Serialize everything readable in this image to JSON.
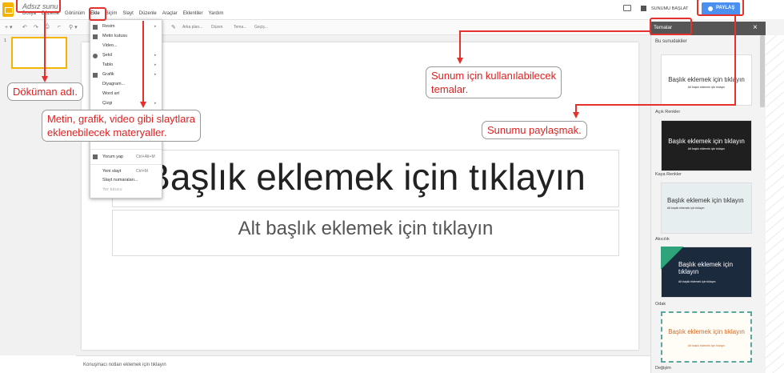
{
  "app": {
    "doc_title": "Adsız sunu",
    "menus": [
      "Dosya",
      "Düzenle",
      "Görünüm",
      "Ekle",
      "Biçim",
      "Slayt",
      "Düzenle",
      "Araçlar",
      "Eklentiler",
      "Yardım"
    ],
    "present_label": "SUNUMU BAŞLAT",
    "share_label": "PAYLAŞ"
  },
  "toolbar": {
    "items": [
      "Arka plan...",
      "Düzen",
      "Tema...",
      "Geçiş..."
    ]
  },
  "slides_panel": {
    "slide_number": "1"
  },
  "slide": {
    "title_placeholder": "Başlık eklemek için tıklayın",
    "subtitle_placeholder": "Alt başlık eklemek için tıklayın"
  },
  "notes": {
    "placeholder": "Konuşmacı notları eklemek için tıklayın"
  },
  "insert_menu": {
    "items": [
      {
        "label": "Resim",
        "arrow": "▸"
      },
      {
        "label": "Metin kutusu",
        "arrow": ""
      },
      {
        "label": "Video...",
        "arrow": ""
      },
      {
        "label": "Şekil",
        "arrow": "▸"
      },
      {
        "label": "Tablo",
        "arrow": "▸"
      },
      {
        "label": "Grafik",
        "arrow": "▸"
      },
      {
        "label": "Diyagram...",
        "arrow": ""
      },
      {
        "label": "Word art",
        "arrow": ""
      },
      {
        "label": "Çizgi",
        "arrow": "▸"
      },
      {
        "label": "Yorum yap",
        "shortcut": "Ctrl+Alt+M"
      },
      {
        "label": "Yeni slayt",
        "shortcut": "Ctrl+M"
      },
      {
        "label": "Slayt numaraları...",
        "shortcut": ""
      },
      {
        "label": "Yer tutucu",
        "shortcut": ""
      }
    ]
  },
  "themes": {
    "title": "Temalar",
    "close": "×",
    "section": "Bu sunudakiler",
    "cards": [
      {
        "name": "",
        "title": "Başlık eklemek için tıklayın",
        "subtitle": "Alt başlık eklemek için tıklayın",
        "bg": "#ffffff",
        "fg": "#333333"
      },
      {
        "name": "Açık Renkler",
        "title": "Başlık eklemek için tıklayın",
        "subtitle": "Alt başlık eklemek için tıklayın",
        "bg": "#1f1f1f",
        "fg": "#ffffff"
      },
      {
        "name": "Kaya Renkler",
        "title": "Başlık eklemek için tıklayın",
        "subtitle": "Alt başlık eklemek için tıklayın",
        "bg": "#e6eef0",
        "fg": "#333333"
      },
      {
        "name": "Akıcılık",
        "title": "Başlık eklemek için tıklayın",
        "subtitle": "Alt başlık eklemek için tıklayın",
        "bg": "#1c2a3e",
        "fg": "#ffffff"
      },
      {
        "name": "Odak",
        "title": "Başlık eklemek için tıklayın",
        "subtitle": "Alt başlık eklemek için tıklayın",
        "bg": "#fffdf5",
        "fg": "#d06a2a"
      },
      {
        "name": "Değişim",
        "title": "",
        "subtitle": "",
        "bg": "#ffffff",
        "fg": "#333333"
      }
    ]
  },
  "annotations": {
    "doc_name": "Döküman adı.",
    "insert_materials": "Metin, grafik, video gibi slaytlara\neklenebilecek materyaller.",
    "themes_usable": "Sunum için kullanılabilecek\ntemalar.",
    "share": "Sunumu paylaşmak."
  },
  "colors": {
    "accent_red": "#e5302b",
    "share_blue": "#4b8ff0",
    "app_yellow": "#f4b400"
  }
}
